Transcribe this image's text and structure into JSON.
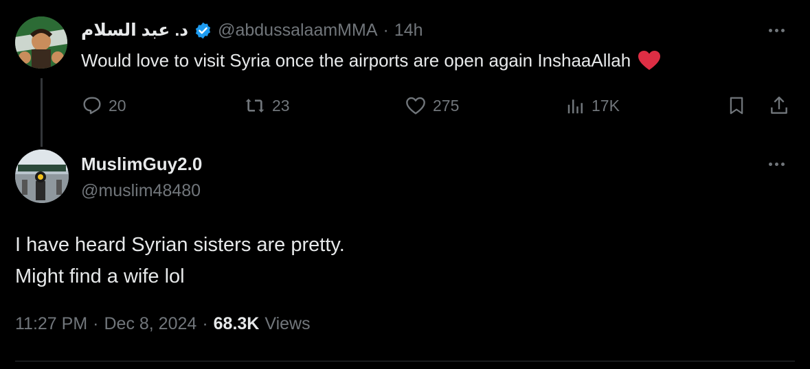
{
  "parent_tweet": {
    "display_name": "د. عبد السلام",
    "handle": "@abdussalaamMMA",
    "separator": "·",
    "time_ago": "14h",
    "text": "Would love to visit Syria once the airports are open again InshaaAllah",
    "emoji": "red-heart",
    "verified_icon": "verified-badge-icon",
    "stats": {
      "replies": "20",
      "reposts": "23",
      "likes": "275",
      "views": "17K"
    }
  },
  "reply_tweet": {
    "display_name": "MuslimGuy2.0",
    "handle": "@muslim48480",
    "text_line1": "I have heard Syrian sisters are pretty.",
    "text_line2": "Might find a wife lol",
    "time": "11:27 PM",
    "sep1": "·",
    "date": "Dec 8, 2024",
    "sep2": "·",
    "views_count": "68.3K",
    "views_label": "Views"
  },
  "colors": {
    "background": "#000000",
    "text": "#e7e9ea",
    "muted": "#71767b",
    "verified": "#1d9bf0",
    "heart": "#f4212e",
    "divider": "#2f3336"
  }
}
